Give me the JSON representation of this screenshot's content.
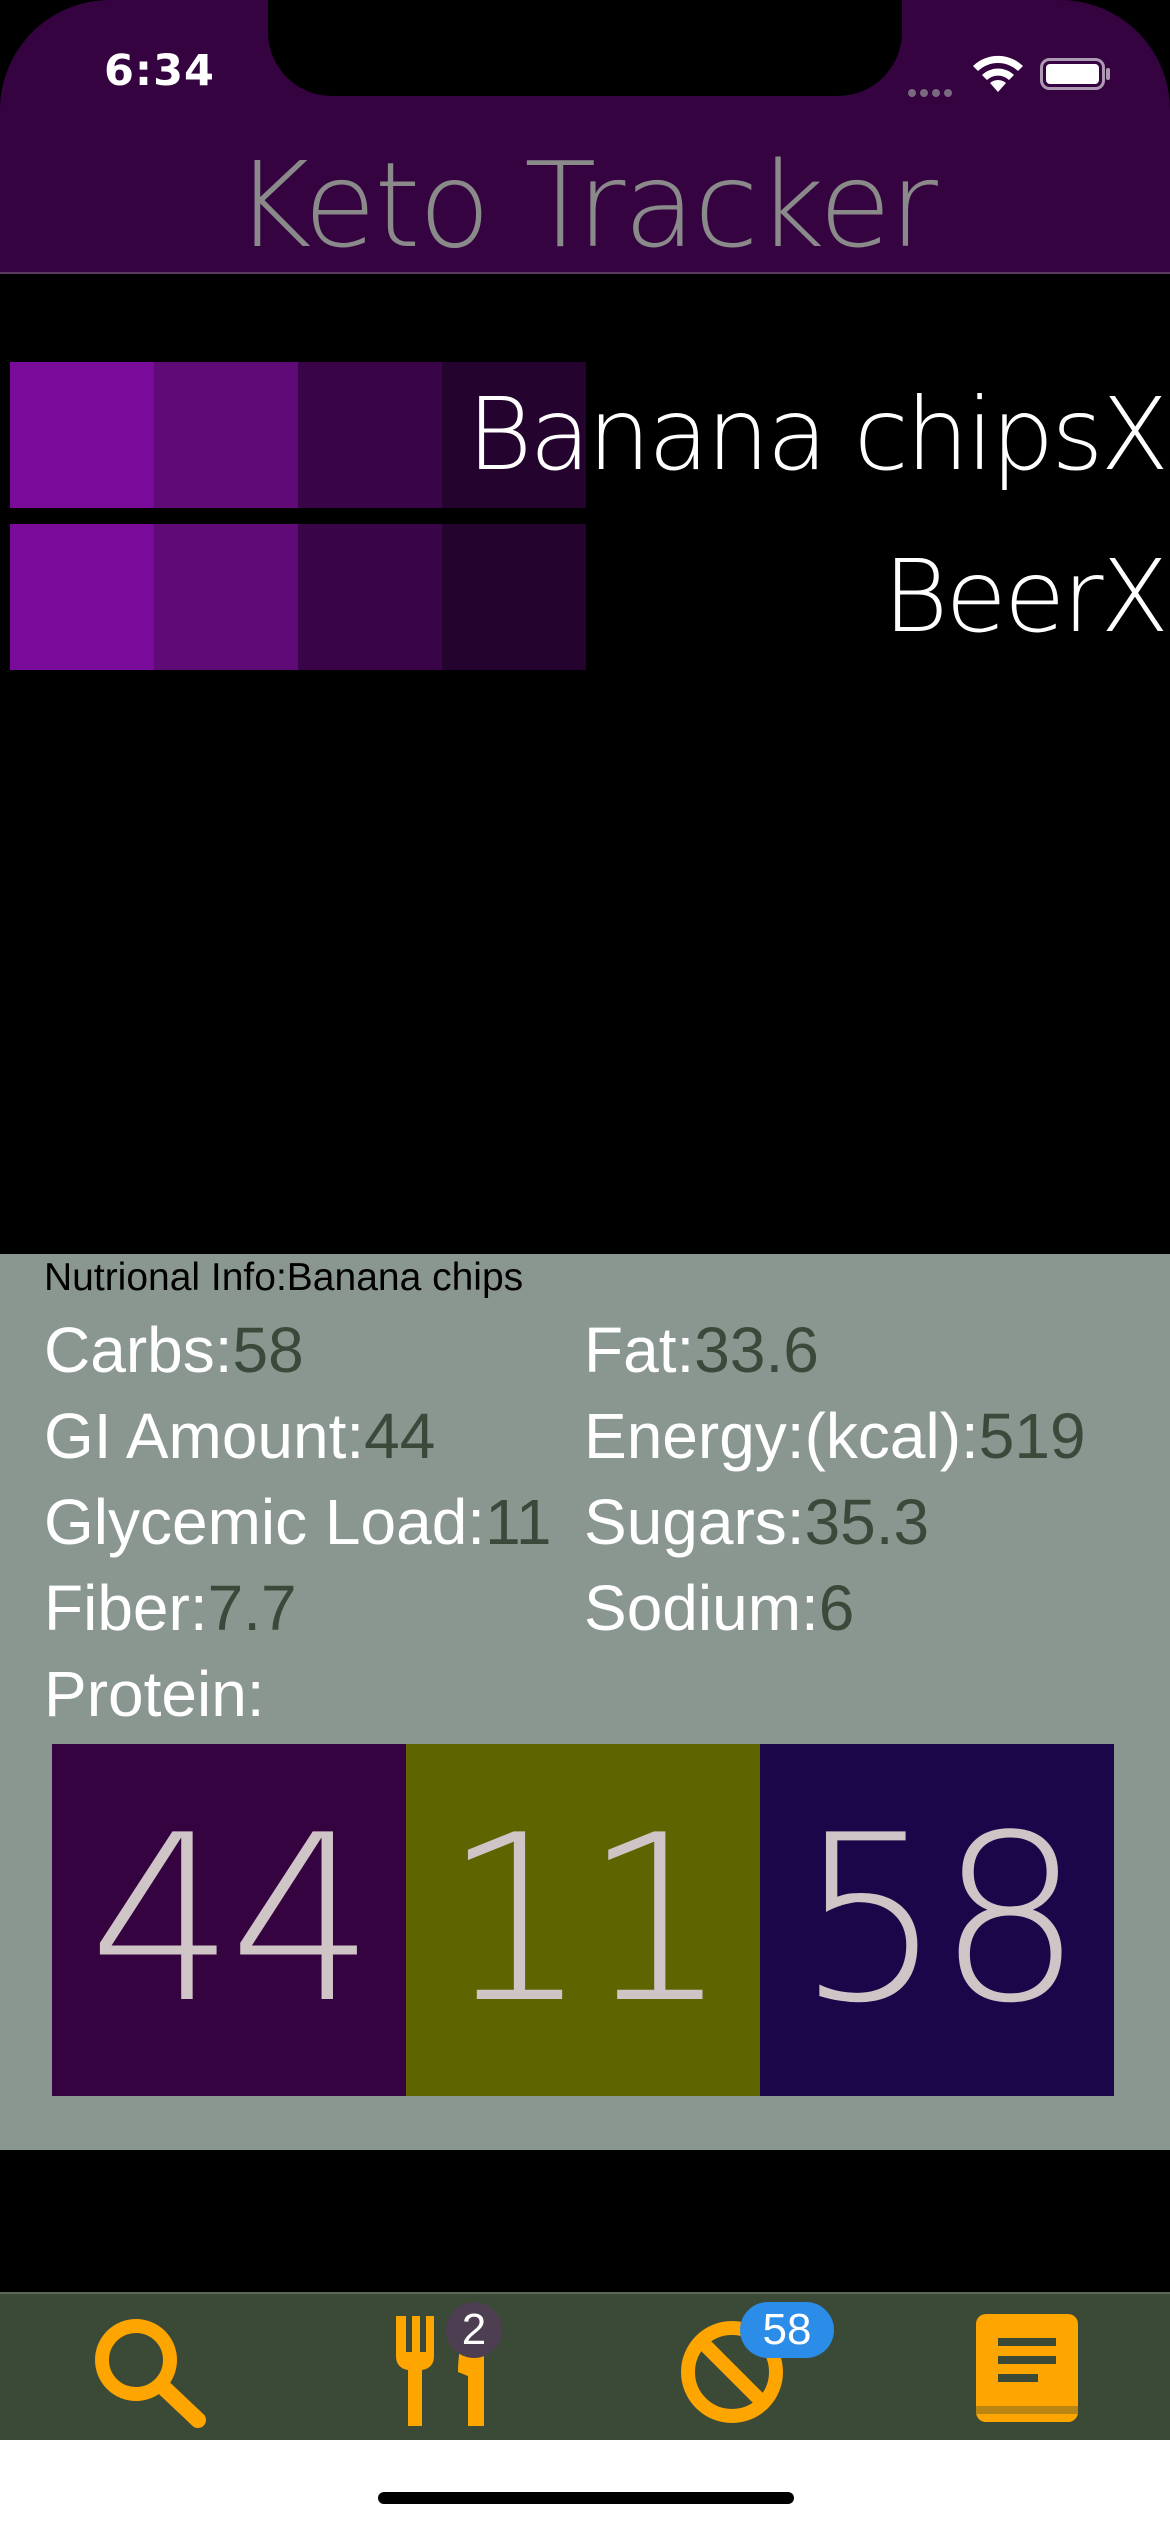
{
  "status_bar": {
    "time": "6:34"
  },
  "header": {
    "title": "Keto Tracker",
    "background": "#340340"
  },
  "foods": [
    {
      "name": "Banana chips",
      "remove_label": "X",
      "swatch_colors": [
        "#7a0a9a",
        "#5f0a76",
        "#3a0548",
        "#24032e"
      ]
    },
    {
      "name": "Beer",
      "remove_label": "X",
      "swatch_colors": [
        "#7a0a9a",
        "#5f0a76",
        "#3a0548",
        "#24032e"
      ]
    }
  ],
  "nutrition": {
    "title": "Nutrional Info:Banana chips",
    "carbs_label": "Carbs:",
    "carbs_value": "58",
    "fat_label": "Fat:",
    "fat_value": "33.6",
    "gi_label": "GI Amount:",
    "gi_value": "44",
    "energy_label": "Energy:(kcal):",
    "energy_value": "519",
    "gl_label": "Glycemic Load:",
    "gl_value": "11",
    "sugars_label": "Sugars:",
    "sugars_value": "35.3",
    "fiber_label": "Fiber:",
    "fiber_value": "7.7",
    "sodium_label": "Sodium:",
    "sodium_value": "6",
    "protein_label": "Protein:",
    "protein_value": "",
    "summary_boxes": [
      {
        "value": "44",
        "color": "#340340"
      },
      {
        "value": "11",
        "color": "#5e6400"
      },
      {
        "value": "58",
        "color": "#1c064a"
      }
    ]
  },
  "tab_bar": {
    "tabs": [
      {
        "icon": "search-icon"
      },
      {
        "icon": "fork-knife-icon",
        "badge": "2",
        "badge_color": "#4e3e52"
      },
      {
        "icon": "prohibited-icon",
        "badge": "58",
        "badge_color": "#2b8de8"
      },
      {
        "icon": "book-icon"
      }
    ],
    "icon_color": "#ffa500"
  }
}
